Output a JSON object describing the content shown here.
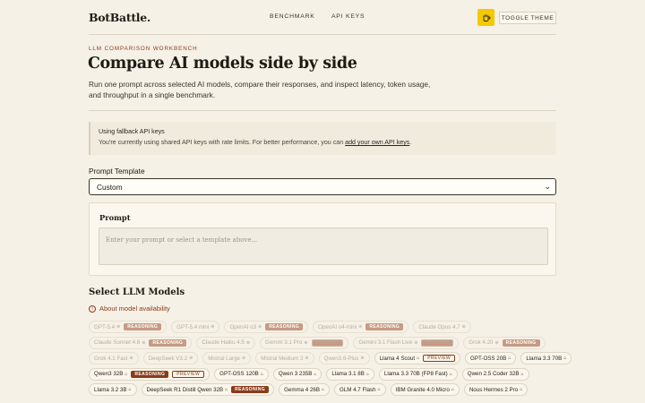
{
  "header": {
    "logo": "BotBattle.",
    "nav": [
      "BENCHMARK",
      "API KEYS"
    ],
    "theme_icon": "cup-icon",
    "toggle_label": "TOGGLE THEME"
  },
  "hero": {
    "eyebrow": "LLM COMPARISON WORKBENCH",
    "title": "Compare AI models side by side",
    "intro": "Run one prompt across selected AI models, compare their responses, and inspect latency, token usage, and throughput in a single benchmark."
  },
  "notice": {
    "title": "Using fallback API keys",
    "body": "You're currently using shared API keys with rate limits. For better performance, you can ",
    "link": "add your own API keys",
    "tail": "."
  },
  "template": {
    "label": "Prompt Template",
    "value": "Custom"
  },
  "prompt": {
    "label": "Prompt",
    "placeholder": "Enter your prompt or select a template above..."
  },
  "models": {
    "title": "Select LLM Models",
    "availability_link": "About model availability",
    "rows": [
      [
        {
          "name": "GPT-5.4",
          "icon": "lock",
          "badge": "REASONING",
          "disabled": true
        },
        {
          "name": "GPT-5.4 mini",
          "icon": "lock",
          "disabled": true
        },
        {
          "name": "OpenAI o3",
          "icon": "lock",
          "badge": "REASONING",
          "disabled": true
        },
        {
          "name": "OpenAI o4-mini",
          "icon": "lock",
          "badge": "REASONING",
          "disabled": true
        },
        {
          "name": "Claude Opus 4.7",
          "icon": "lock",
          "disabled": true
        }
      ],
      [
        {
          "name": "Claude Sonnet 4.6",
          "icon": "lock",
          "badge": "REASONING",
          "disabled": true
        },
        {
          "name": "Claude Haiku 4.5",
          "icon": "lock",
          "disabled": true
        },
        {
          "name": "Gemini 3.1 Pro",
          "icon": "lock",
          "badge": "PREVIEW",
          "badge_style": "outline",
          "disabled": true
        },
        {
          "name": "Gemini 3.1 Flash Live",
          "icon": "lock",
          "badge": "PREVIEW",
          "badge_style": "outline",
          "disabled": true
        },
        {
          "name": "Grok 4.20",
          "icon": "lock",
          "badge": "REASONING",
          "disabled": true
        }
      ],
      [
        {
          "name": "Grok 4.1 Fast",
          "icon": "lock",
          "disabled": true
        },
        {
          "name": "DeepSeek V3.2",
          "icon": "lock",
          "disabled": true
        },
        {
          "name": "Mistral Large",
          "icon": "lock",
          "disabled": true
        },
        {
          "name": "Mistral Medium 3",
          "icon": "lock",
          "disabled": true
        },
        {
          "name": "Qwen3.6-Plus",
          "icon": "lock",
          "disabled": true
        },
        {
          "name": "Llama 4 Scout",
          "icon": "free",
          "badge": "PREVIEW",
          "badge_style": "outline",
          "disabled": false
        },
        {
          "name": "GPT-OSS 20B",
          "icon": "free",
          "disabled": false
        },
        {
          "name": "Llama 3.3 70B",
          "icon": "free",
          "disabled": false
        }
      ],
      [
        {
          "name": "Qwen3 32B",
          "icon": "free",
          "badge": "REASONING",
          "extra_badge": "PREVIEW",
          "disabled": false
        },
        {
          "name": "GPT-OSS 120B",
          "icon": "free",
          "disabled": false
        },
        {
          "name": "Qwen 3 235B",
          "icon": "free",
          "disabled": false
        },
        {
          "name": "Llama 3.1 8B",
          "icon": "free",
          "disabled": false
        },
        {
          "name": "Llama 3.3 70B (FP8 Fast)",
          "icon": "free",
          "disabled": false
        },
        {
          "name": "Qwen 2.5 Coder 32B",
          "icon": "free",
          "disabled": false
        }
      ],
      [
        {
          "name": "Llama 3.2 3B",
          "icon": "free",
          "disabled": false
        },
        {
          "name": "DeepSeek R1 Distill Qwen 32B",
          "icon": "free",
          "badge": "REASONING",
          "disabled": false
        },
        {
          "name": "Gemma 4 26B",
          "icon": "free",
          "disabled": false
        },
        {
          "name": "GLM 4.7 Flash",
          "icon": "free",
          "disabled": false
        },
        {
          "name": "IBM Granite 4.0 Micro",
          "icon": "free",
          "disabled": false
        },
        {
          "name": "Nous Hermes 2 Pro",
          "icon": "free",
          "disabled": false
        }
      ]
    ]
  },
  "colors": {
    "background": "#f6f1e6",
    "accent": "#8a3b1a",
    "theme_button": "#f4c900"
  }
}
